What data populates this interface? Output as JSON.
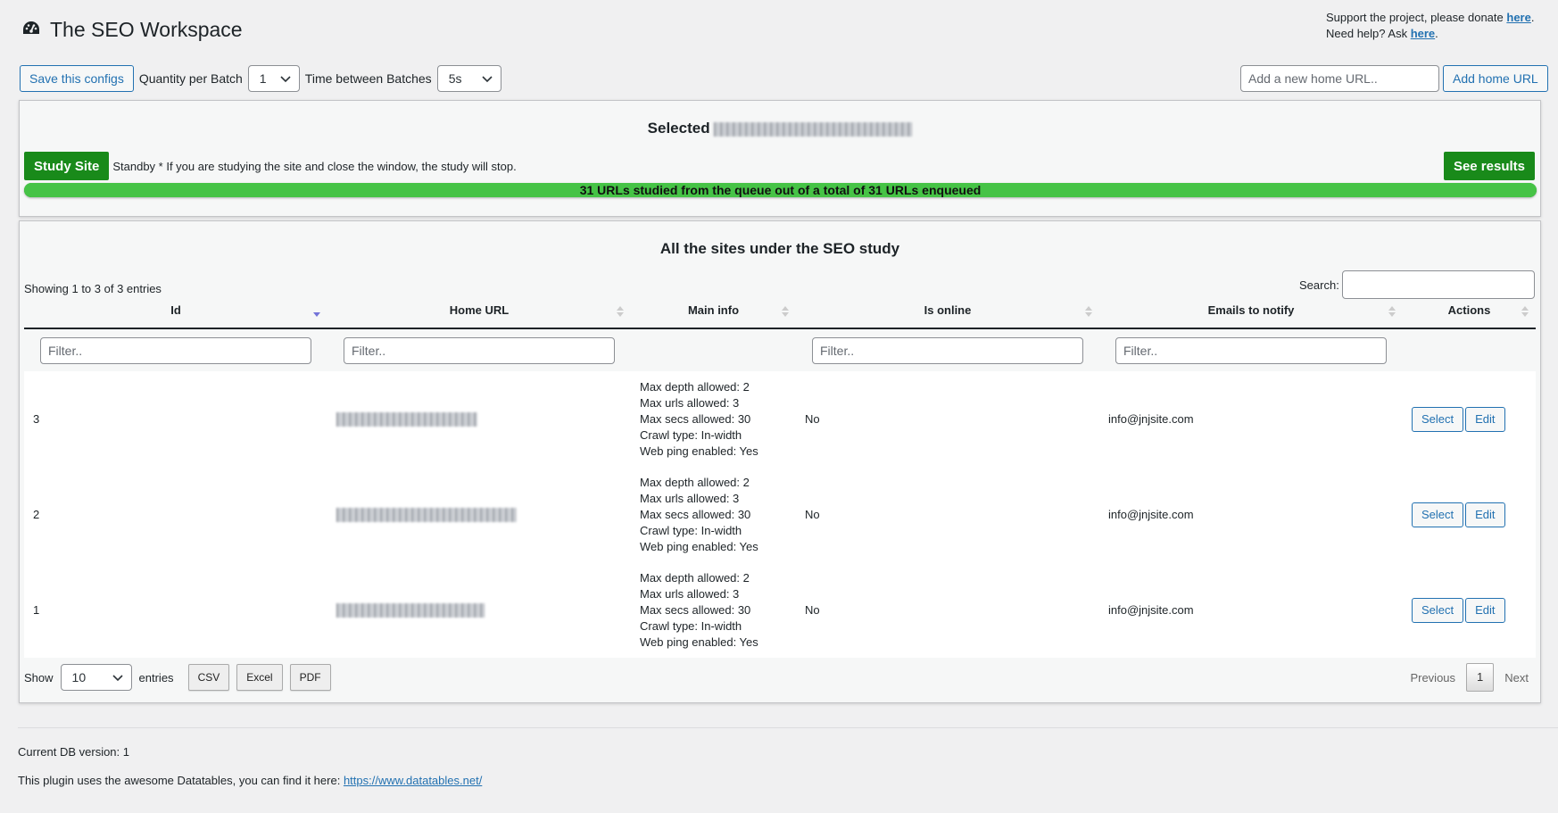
{
  "header": {
    "title": "The SEO Workspace",
    "support_text": "Support the project, please donate ",
    "support_link": "here",
    "help_text": "Need help? Ask ",
    "help_link": "here"
  },
  "toolbar": {
    "save_button": "Save this configs",
    "qty_label": "Quantity per Batch",
    "qty_value": "1",
    "time_label": "Time between Batches",
    "time_value": "5s",
    "home_url_placeholder": "Add a new home URL..",
    "add_home_button": "Add home URL"
  },
  "study": {
    "selected_label": "Selected",
    "study_button": "Study Site",
    "standby_text": "Standby * If you are studying the site and close the window, the study will stop.",
    "see_results_button": "See results",
    "progress_text": "31 URLs studied from the queue out of a total of 31 URLs enqueued",
    "progress_fraction": 1.0
  },
  "sites": {
    "title": "All the sites under the SEO study",
    "showing": "Showing 1 to 3 of 3 entries",
    "search_label": "Search:",
    "columns": [
      "Id",
      "Home URL",
      "Main info",
      "Is online",
      "Emails to notify",
      "Actions"
    ],
    "filter_placeholder": "Filter..",
    "rows": [
      {
        "id": "3",
        "main_info": [
          "Max depth allowed: 2",
          "Max urls allowed: 3",
          "Max secs allowed: 30",
          "Crawl type: In-width",
          "Web ping enabled: Yes"
        ],
        "is_online": "No",
        "email": "info@jnjsite.com",
        "select": "Select",
        "edit": "Edit"
      },
      {
        "id": "2",
        "main_info": [
          "Max depth allowed: 2",
          "Max urls allowed: 3",
          "Max secs allowed: 30",
          "Crawl type: In-width",
          "Web ping enabled: Yes"
        ],
        "is_online": "No",
        "email": "info@jnjsite.com",
        "select": "Select",
        "edit": "Edit"
      },
      {
        "id": "1",
        "main_info": [
          "Max depth allowed: 2",
          "Max urls allowed: 3",
          "Max secs allowed: 30",
          "Crawl type: In-width",
          "Web ping enabled: Yes"
        ],
        "is_online": "No",
        "email": "info@jnjsite.com",
        "select": "Select",
        "edit": "Edit"
      }
    ],
    "show_label": "Show",
    "show_value": "10",
    "entries_label": "entries",
    "export_buttons": [
      "CSV",
      "Excel",
      "PDF"
    ],
    "pager": {
      "previous": "Previous",
      "current": "1",
      "next": "Next"
    }
  },
  "footer": {
    "db_version": "Current DB version: 1",
    "plugin_note": "This plugin uses the awesome Datatables, you can find it here: ",
    "plugin_link": "https://www.datatables.net/"
  },
  "colors": {
    "accent": "#2271b1",
    "green_button": "#198a1a",
    "progress": "#46c346"
  }
}
